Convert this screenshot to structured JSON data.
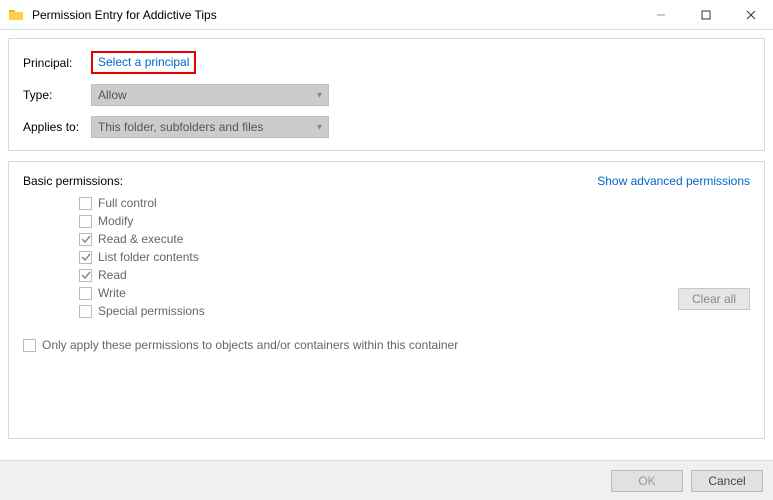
{
  "window": {
    "title": "Permission Entry for Addictive Tips"
  },
  "principal": {
    "label": "Principal:",
    "link_text": "Select a principal"
  },
  "type": {
    "label": "Type:",
    "value": "Allow"
  },
  "applies_to": {
    "label": "Applies to:",
    "value": "This folder, subfolders and files"
  },
  "permissions": {
    "section_label": "Basic permissions:",
    "advanced_link": "Show advanced permissions",
    "items": [
      {
        "label": "Full control",
        "checked": false
      },
      {
        "label": "Modify",
        "checked": false
      },
      {
        "label": "Read & execute",
        "checked": true
      },
      {
        "label": "List folder contents",
        "checked": true
      },
      {
        "label": "Read",
        "checked": true
      },
      {
        "label": "Write",
        "checked": false
      },
      {
        "label": "Special permissions",
        "checked": false
      }
    ],
    "only_apply_label": "Only apply these permissions to objects and/or containers within this container",
    "only_apply_checked": false,
    "clear_all": "Clear all"
  },
  "footer": {
    "ok": "OK",
    "cancel": "Cancel"
  }
}
